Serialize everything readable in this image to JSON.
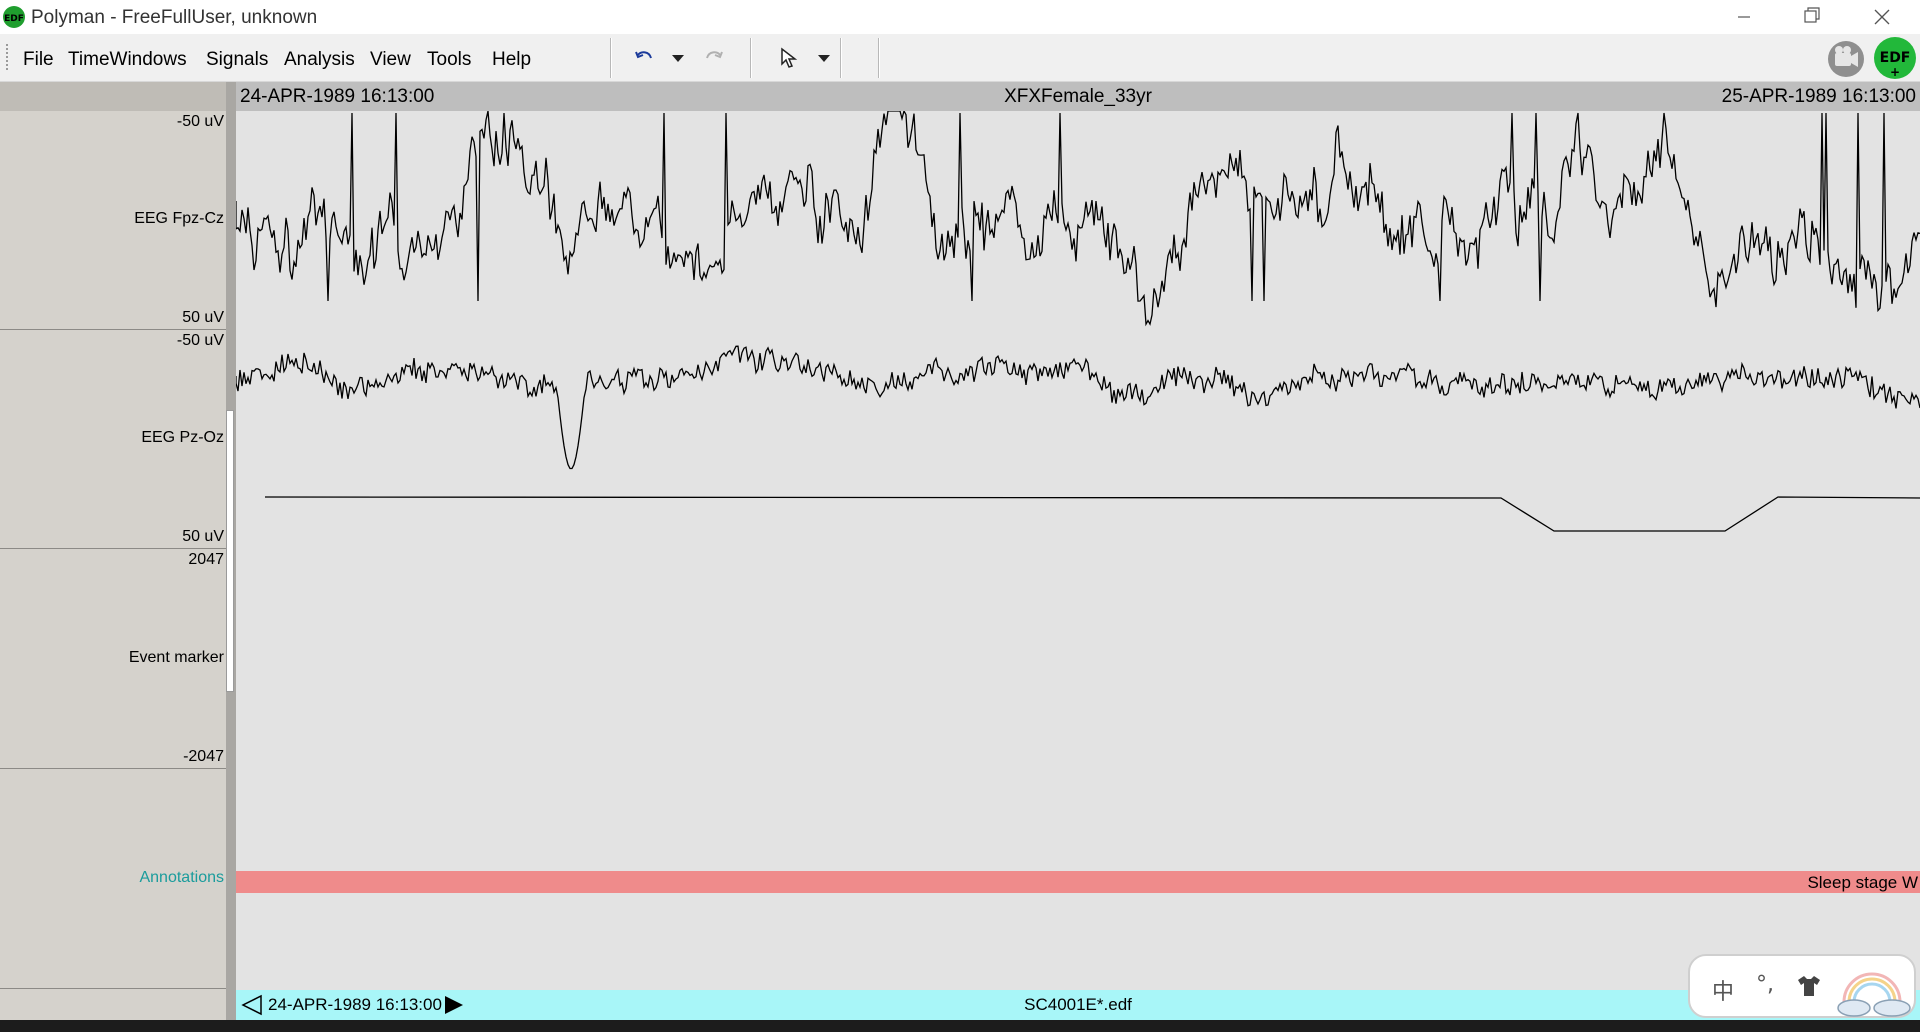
{
  "window": {
    "title": "Polyman - FreeFullUser, unknown",
    "app_icon": "edf-logo-icon",
    "controls": [
      "minimize-icon",
      "restore-icon",
      "close-icon"
    ]
  },
  "menu": {
    "items": [
      "File",
      "TimeWindows",
      "Signals",
      "Analysis",
      "View",
      "Tools",
      "Help"
    ],
    "toolbar_icons": [
      "undo-icon",
      "dropdown-arrow-icon",
      "redo-icon",
      "pointer-icon",
      "dropdown-arrow-icon"
    ],
    "right_icons": [
      "video-icon",
      "edf-plus-icon"
    ],
    "edf_plus_text": "EDF"
  },
  "header": {
    "start_time": "24-APR-1989 16:13:00",
    "patient": "XFXFemale_33yr",
    "end_time": "25-APR-1989 16:13:00"
  },
  "channels": [
    {
      "label": "EEG Fpz-Cz",
      "scale_top": "-50 uV",
      "scale_bottom": "50 uV"
    },
    {
      "label": "EEG Pz-Oz",
      "scale_top": "-50 uV",
      "scale_bottom": "50 uV"
    },
    {
      "label": "Event marker",
      "scale_top": "2047",
      "scale_bottom": "-2047"
    },
    {
      "label": "Annotations",
      "scale_top": "",
      "scale_bottom": ""
    }
  ],
  "annotation": {
    "text": "Sleep stage W",
    "color": "#ef8b8b"
  },
  "status": {
    "time": "24-APR-1989 16:13:00",
    "file": "SC4001E*.edf",
    "color": "#a8f6f8"
  },
  "ime": {
    "char": "中",
    "punct": "°,"
  },
  "colors": {
    "panel": "#d5d2cc",
    "plot_bg": "#e3e3e3",
    "trace": "#000000",
    "annot_label": "#1a9c9c"
  }
}
